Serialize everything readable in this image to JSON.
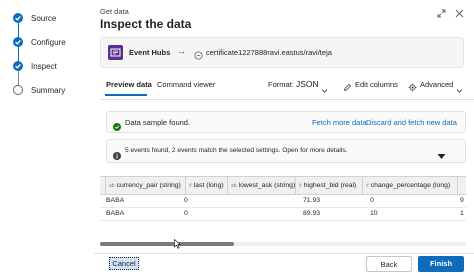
{
  "stepper": {
    "steps": [
      {
        "label": "Source",
        "state": "done"
      },
      {
        "label": "Configure",
        "state": "done"
      },
      {
        "label": "Inspect",
        "state": "current"
      },
      {
        "label": "Summary",
        "state": "todo"
      }
    ]
  },
  "header": {
    "breadcrumb": "Get data",
    "title": "Inspect the data",
    "icons": [
      "expand-icon",
      "close-icon"
    ]
  },
  "source": {
    "name": "Event Hubs",
    "target": "certificate1227888ravi.eastus/ravi/teja"
  },
  "tabs": {
    "preview": "Preview data",
    "command": "Command viewer"
  },
  "format": {
    "label": "Format:",
    "value": "JSON"
  },
  "actions": {
    "edit_columns": "Edit columns",
    "advanced": "Advanced"
  },
  "sample_bar": {
    "message": "Data sample found.",
    "fetch_more": "Fetch more data",
    "discard": "Discard and fetch new data"
  },
  "events_bar": {
    "message": "5 events found, 2 events match the selected settings. Open for more details."
  },
  "table": {
    "columns": [
      {
        "name": "currency_pair",
        "type": "(string)"
      },
      {
        "name": "last",
        "type": "(long)"
      },
      {
        "name": "lowest_ask",
        "type": "(string)"
      },
      {
        "name": "highest_bid",
        "type": "(real)"
      },
      {
        "name": "change_percentage",
        "type": "(long)"
      }
    ],
    "rows": [
      [
        "BABA",
        "0",
        "",
        "71.93",
        "0",
        "9"
      ],
      [
        "BABA",
        "0",
        "",
        "89.93",
        "10",
        "1"
      ]
    ]
  },
  "footer": {
    "cancel": "Cancel",
    "back": "Back",
    "finish": "Finish"
  },
  "colors": {
    "accent": "#0f6cbd",
    "success": "#107c10",
    "event_hubs": "#5b2e91"
  }
}
